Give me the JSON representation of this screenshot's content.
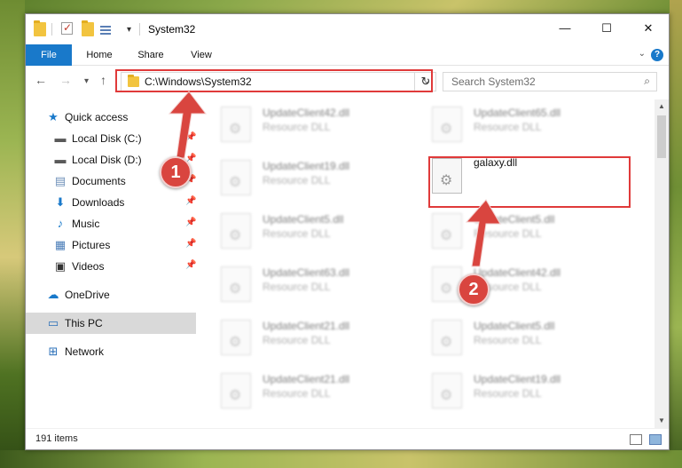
{
  "window": {
    "title": "System32",
    "controls": {
      "minimize": "—",
      "maximize": "☐",
      "close": "✕"
    }
  },
  "ribbon": {
    "tabs": [
      "File",
      "Home",
      "Share",
      "View"
    ],
    "help": "?"
  },
  "nav": {
    "address": "C:\\Windows\\System32",
    "search_placeholder": "Search System32"
  },
  "sidebar": {
    "items": [
      {
        "label": "Quick access",
        "icon": "star-icon",
        "glyph": "★",
        "color": "#1979ca",
        "pinned": false
      },
      {
        "label": "Local Disk (C:)",
        "icon": "drive-icon",
        "glyph": "▬",
        "color": "#5a5a5a",
        "pinned": true
      },
      {
        "label": "Local Disk (D:)",
        "icon": "drive-icon",
        "glyph": "▬",
        "color": "#5a5a5a",
        "pinned": true
      },
      {
        "label": "Documents",
        "icon": "documents-icon",
        "glyph": "▤",
        "color": "#6d8fb8",
        "pinned": true
      },
      {
        "label": "Downloads",
        "icon": "download-icon",
        "glyph": "⬇",
        "color": "#1979ca",
        "pinned": true
      },
      {
        "label": "Music",
        "icon": "music-icon",
        "glyph": "♪",
        "color": "#1979ca",
        "pinned": true
      },
      {
        "label": "Pictures",
        "icon": "pictures-icon",
        "glyph": "▦",
        "color": "#4a7db8",
        "pinned": true
      },
      {
        "label": "Videos",
        "icon": "video-icon",
        "glyph": "▣",
        "color": "#333333",
        "pinned": true
      },
      {
        "label": "OneDrive",
        "icon": "cloud-icon",
        "glyph": "☁",
        "color": "#1979ca",
        "pinned": false
      },
      {
        "label": "This PC",
        "icon": "computer-icon",
        "glyph": "▭",
        "color": "#2a6fb8",
        "pinned": false
      },
      {
        "label": "Network",
        "icon": "network-icon",
        "glyph": "⊞",
        "color": "#2a6fb8",
        "pinned": false
      }
    ]
  },
  "files": {
    "left": [
      {
        "name": "UpdateClient42.dll",
        "type": "Resource DLL"
      },
      {
        "name": "UpdateClient19.dll",
        "type": "Resource DLL"
      },
      {
        "name": "UpdateClient5.dll",
        "type": "Resource DLL"
      },
      {
        "name": "UpdateClient63.dll",
        "type": "Resource DLL"
      },
      {
        "name": "UpdateClient21.dll",
        "type": "Resource DLL"
      },
      {
        "name": "UpdateClient21.dll",
        "type": "Resource DLL"
      }
    ],
    "right": [
      {
        "name": "UpdateClient65.dll",
        "type": "Resource DLL"
      },
      {
        "name": "galaxy.dll",
        "type": ""
      },
      {
        "name": "UpdateClient5.dll",
        "type": "Resource DLL"
      },
      {
        "name": "UpdateClient42.dll",
        "type": "Resource DLL"
      },
      {
        "name": "UpdateClient5.dll",
        "type": "Resource DLL"
      },
      {
        "name": "UpdateClient19.dll",
        "type": "Resource DLL"
      }
    ]
  },
  "status": {
    "item_count": "191 items"
  },
  "annotations": {
    "marker1": "1",
    "marker2": "2",
    "color": "#e03a3a"
  }
}
